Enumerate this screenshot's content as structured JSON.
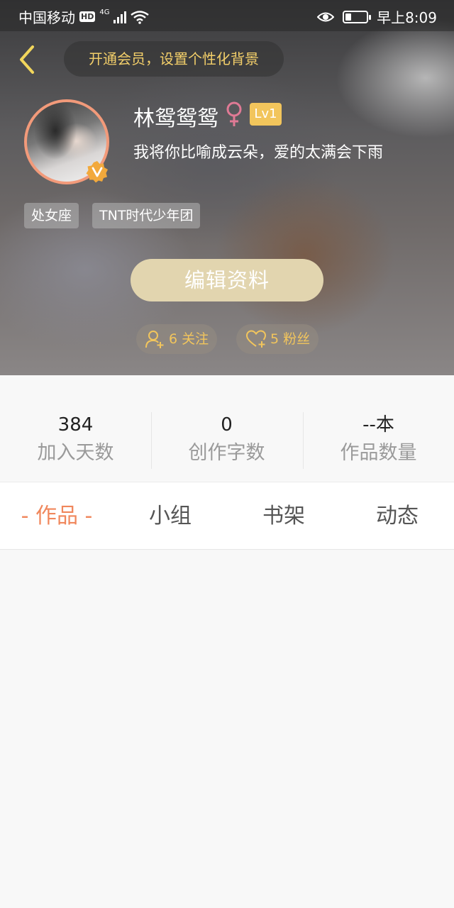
{
  "status_bar": {
    "carrier": "中国移动",
    "hd": "HD",
    "network": "4G",
    "time": "早上8:09",
    "battery_level": 0.3
  },
  "header": {
    "vip_banner": "开通会员，设置个性化背景",
    "username": "林鸳鸳鸳",
    "gender_symbol": "♀",
    "level": "Lv1",
    "signature": "我将你比喻成云朵，爱的太满会下雨",
    "tags": [
      "处女座",
      "TNT时代少年团"
    ],
    "edit_button": "编辑资料",
    "following": "6 关注",
    "followers": "5 粉丝"
  },
  "stats": [
    {
      "value": "384",
      "label": "加入天数"
    },
    {
      "value": "0",
      "label": "创作字数"
    },
    {
      "value": "--本",
      "label": "作品数量"
    }
  ],
  "tabs": [
    {
      "label": "- 作品 -",
      "active": true
    },
    {
      "label": "小组",
      "active": false
    },
    {
      "label": "书架",
      "active": false
    },
    {
      "label": "动态",
      "active": false
    }
  ],
  "colors": {
    "accent_orange": "#f0875c",
    "gold": "#f2c55c",
    "edit_button": "#e2d5af",
    "gender_pink": "#e07a95"
  },
  "icons": [
    "back-chevron-icon",
    "eye-icon",
    "verified-v-badge-icon",
    "female-icon",
    "add-user-icon",
    "heart-plus-icon",
    "wifi-icon",
    "signal-icon",
    "battery-icon"
  ]
}
